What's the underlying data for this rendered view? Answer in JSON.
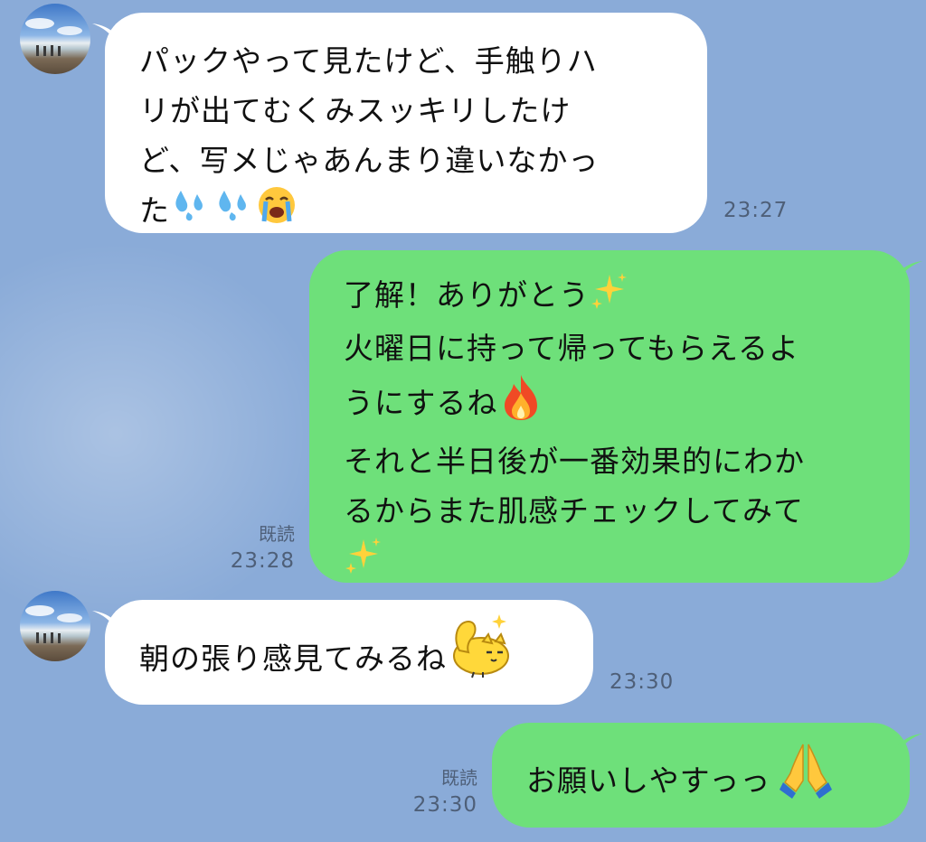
{
  "messages": [
    {
      "id": "m1",
      "direction": "incoming",
      "text": "パックやって見たけど、手触りハリが出てむくみスッキリしたけど、写メじゃあんまり違いなかった",
      "lines": [
        "パックやって見たけど、手触りハ",
        "リが出てむくみスッキリしたけ",
        "ど、写メじゃあんまり違いなかっ",
        "た"
      ],
      "emojis": [
        "sweat-droplets-icon",
        "sweat-droplets-icon",
        "loudly-crying-face-icon"
      ],
      "time": "23:27"
    },
    {
      "id": "m2",
      "direction": "outgoing",
      "lines": [
        "了解！ありがとう",
        "火曜日に持って帰ってもらえるよ",
        "うにするね",
        "それと半日後が一番効果的にわか",
        "るからまた肌感チェックしてみて",
        ""
      ],
      "emojis": [
        "sparkles-icon",
        "fire-icon",
        "sparkles-icon"
      ],
      "read": "既読",
      "time": "23:28"
    },
    {
      "id": "m3",
      "direction": "incoming",
      "lines": [
        "朝の張り感見てみるね"
      ],
      "emojis": [
        "flexing-cat-sticker-icon"
      ],
      "time": "23:30"
    },
    {
      "id": "m4",
      "direction": "outgoing",
      "lines": [
        "お願いしやすっっ"
      ],
      "emojis": [
        "folded-hands-icon"
      ],
      "read": "既読",
      "time": "23:30"
    }
  ],
  "colors": {
    "background": "#8aabd8",
    "incoming_bubble": "#ffffff",
    "outgoing_bubble": "#6ee07a",
    "meta_text": "#4e5f78"
  }
}
